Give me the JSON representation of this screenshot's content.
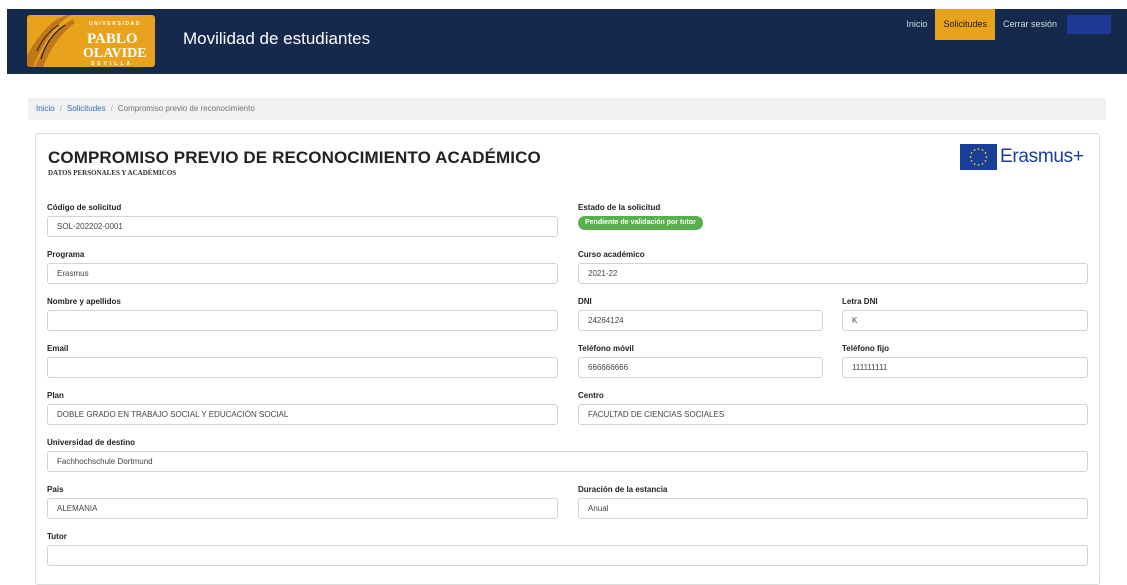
{
  "header": {
    "site_title": "Movilidad de estudiantes",
    "logo": {
      "line1": "UNIVERSIDAD",
      "line2": "PABLO",
      "line3": "OLAVIDE",
      "line4": "SEVILLA"
    },
    "nav": [
      {
        "label": "Inicio",
        "active": false
      },
      {
        "label": "Solicitudes",
        "active": true
      },
      {
        "label": "Cerrar sesión",
        "active": false
      }
    ],
    "accent_color": "#e9a21b",
    "bg_color": "#14294b"
  },
  "breadcrumb": {
    "items": [
      "Inicio",
      "Solicitudes",
      "Compromiso previo de reconocimiento"
    ]
  },
  "form": {
    "title": "COMPROMISO PREVIO DE RECONOCIMIENTO ACADÉMICO",
    "subtitle": "DATOS PERSONALES Y ACADÉMICOS",
    "brand": "Erasmus+",
    "fields": {
      "codigo": {
        "label": "Código de solicitud",
        "value": "SOL-202202-0001"
      },
      "estado": {
        "label": "Estado de la solicitud",
        "value": "Pendiente de validación por tutor"
      },
      "programa": {
        "label": "Programa",
        "value": "Erasmus"
      },
      "curso": {
        "label": "Curso académico",
        "value": "2021-22"
      },
      "nombre": {
        "label": "Nombre y apellidos",
        "value": ""
      },
      "dni": {
        "label": "DNI",
        "value": "24264124"
      },
      "letra": {
        "label": "Letra DNI",
        "value": "K"
      },
      "email": {
        "label": "Email",
        "value": ""
      },
      "movil": {
        "label": "Teléfono móvil",
        "value": "666666666"
      },
      "fijo": {
        "label": "Teléfono fijo",
        "value": "111111111"
      },
      "plan": {
        "label": "Plan",
        "value": "DOBLE GRADO EN TRABAJO SOCIAL Y EDUCACIÓN SOCIAL"
      },
      "centro": {
        "label": "Centro",
        "value": "FACULTAD DE CIENCIAS SOCIALES"
      },
      "universidad": {
        "label": "Universidad de destino",
        "value": "Fachhochschule Dortmund"
      },
      "pais": {
        "label": "País",
        "value": "ALEMANIA"
      },
      "duracion": {
        "label": "Duración de la estancia",
        "value": "Anual"
      },
      "tutor": {
        "label": "Tutor",
        "value": ""
      }
    }
  }
}
